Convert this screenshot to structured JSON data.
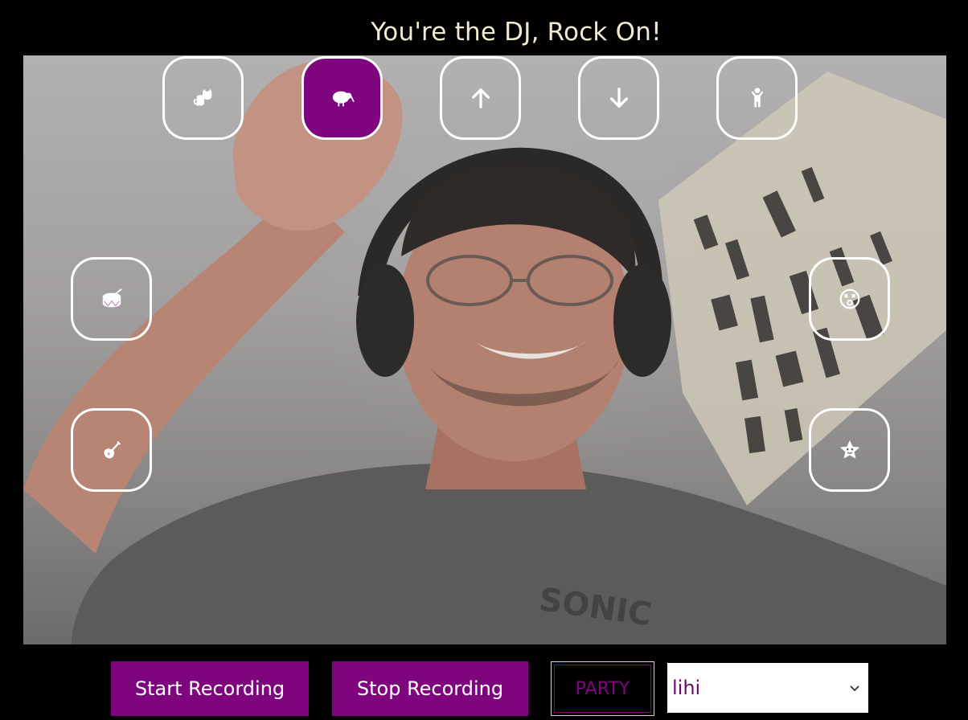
{
  "header": {
    "title": "You're the DJ, Rock On!"
  },
  "pads": [
    {
      "name": "cat-pad",
      "icon": "cat-icon",
      "active": false
    },
    {
      "name": "kiwi-bird-pad",
      "icon": "kiwi-bird-icon",
      "active": true
    },
    {
      "name": "arrow-up-pad",
      "icon": "arrow-up-icon",
      "active": false
    },
    {
      "name": "arrow-down-pad",
      "icon": "arrow-down-icon",
      "active": false
    },
    {
      "name": "child-pad",
      "icon": "child-icon",
      "active": false
    },
    {
      "name": "drum-pad",
      "icon": "drum-icon",
      "active": false
    },
    {
      "name": "dizzy-face-pad",
      "icon": "dizzy-face-icon",
      "active": false
    },
    {
      "name": "guitar-pad",
      "icon": "guitar-icon",
      "active": false
    },
    {
      "name": "star-face-pad",
      "icon": "star-face-icon",
      "active": false
    }
  ],
  "controls": {
    "start_label": "Start Recording",
    "stop_label": "Stop Recording",
    "party_label": "PARTY",
    "select_value": "lihi"
  },
  "colors": {
    "accent": "#7f057f",
    "background": "#000000",
    "title": "#f3ead3",
    "pad_border": "#ffffff"
  }
}
